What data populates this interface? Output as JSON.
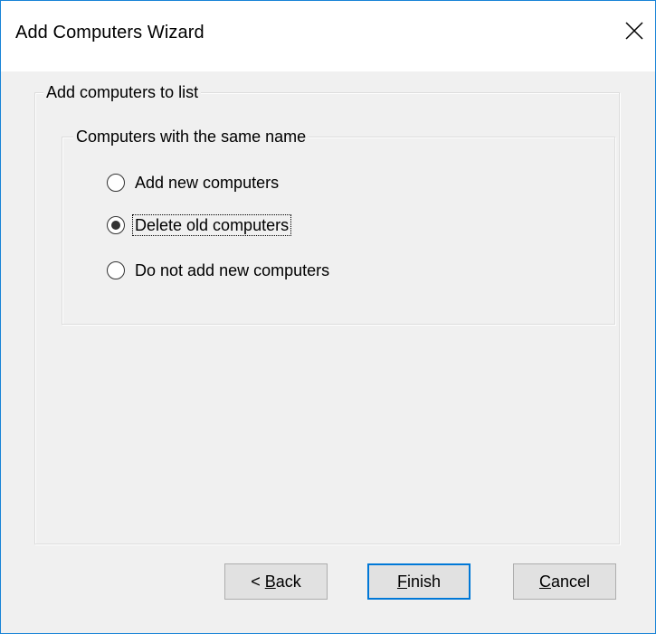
{
  "window": {
    "title": "Add Computers Wizard",
    "close_icon": "close-icon"
  },
  "outer_group": {
    "label": "Add computers to list"
  },
  "inner_group": {
    "label": "Computers with the same name",
    "options": [
      {
        "label": "Add new computers",
        "checked": false
      },
      {
        "label": "Delete old computers",
        "checked": true
      },
      {
        "label": "Do not add new computers",
        "checked": false
      }
    ]
  },
  "buttons": {
    "back": {
      "prefix": "< ",
      "mnemonic": "B",
      "rest": "ack"
    },
    "finish": {
      "prefix": "",
      "mnemonic": "F",
      "rest": "inish"
    },
    "cancel": {
      "prefix": "",
      "mnemonic": "C",
      "rest": "ancel"
    }
  },
  "colors": {
    "window_border": "#1883d7",
    "dialog_bg": "#f0f0f0",
    "default_button_border": "#0078d7",
    "button_bg": "#e1e1e1"
  }
}
